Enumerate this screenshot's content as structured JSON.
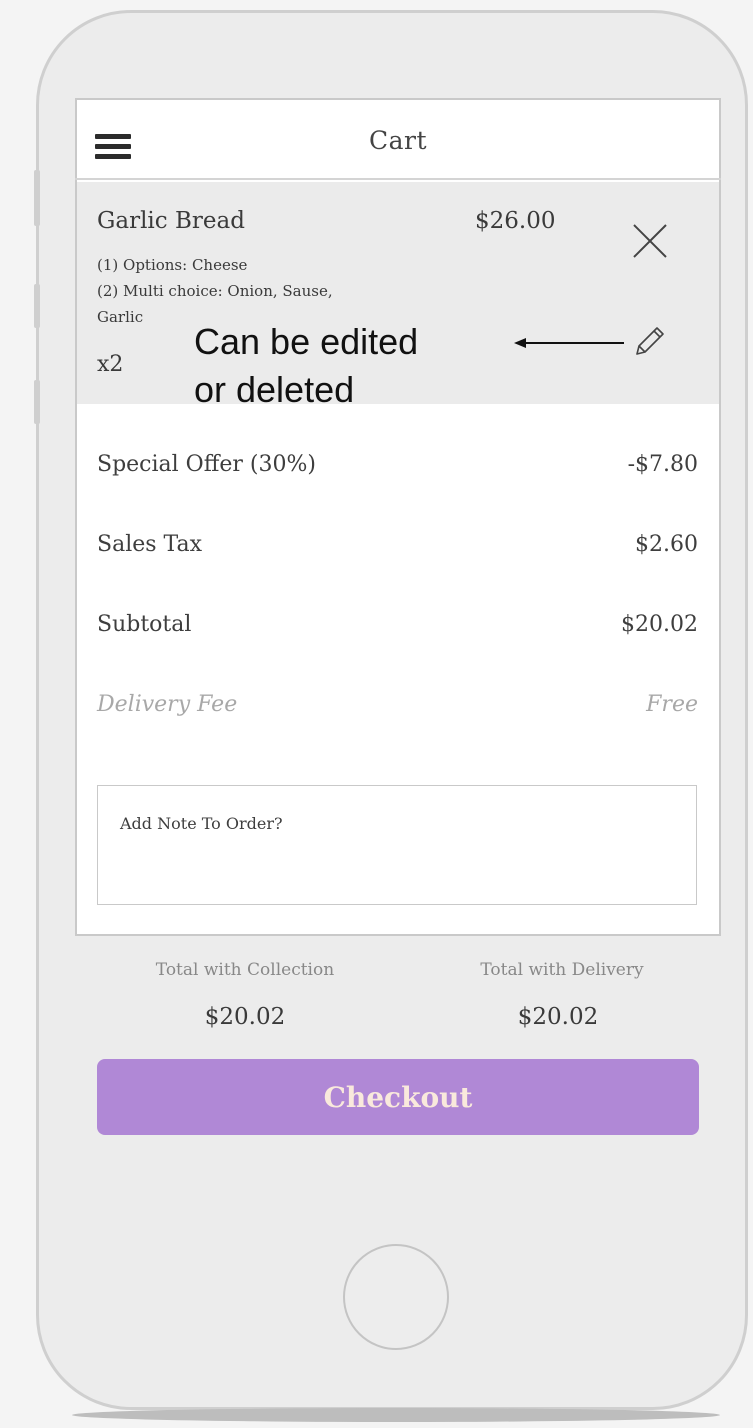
{
  "header": {
    "title": "Cart"
  },
  "cart_item": {
    "name": "Garlic Bread",
    "price": "$26.00",
    "option_1": "(1) Options: Cheese",
    "option_2": "(2) Multi choice: Onion, Sause,",
    "option_3": "Garlic",
    "quantity": "x2"
  },
  "annotation": {
    "text": "Can be edited\nor deleted"
  },
  "summary": [
    {
      "label": "Special Offer (30%)",
      "value": "-$7.80"
    },
    {
      "label": "Sales Tax",
      "value": "$2.60"
    },
    {
      "label": "Subtotal",
      "value": "$20.02"
    },
    {
      "label": "Delivery Fee",
      "value": "Free"
    }
  ],
  "note": {
    "placeholder": "Add Note To Order?"
  },
  "totals": {
    "collection_label": "Total with Collection",
    "collection_value": "$20.02",
    "delivery_label": "Total with Delivery",
    "delivery_value": "$20.02"
  },
  "checkout": {
    "label": "Checkout"
  },
  "colors": {
    "checkout_bg": "#b088d6",
    "checkout_text": "#f9e9dc",
    "item_bg": "#ebebeb"
  },
  "icons": [
    "menu-icon",
    "close-icon",
    "pencil-icon",
    "arrow-left-icon"
  ]
}
